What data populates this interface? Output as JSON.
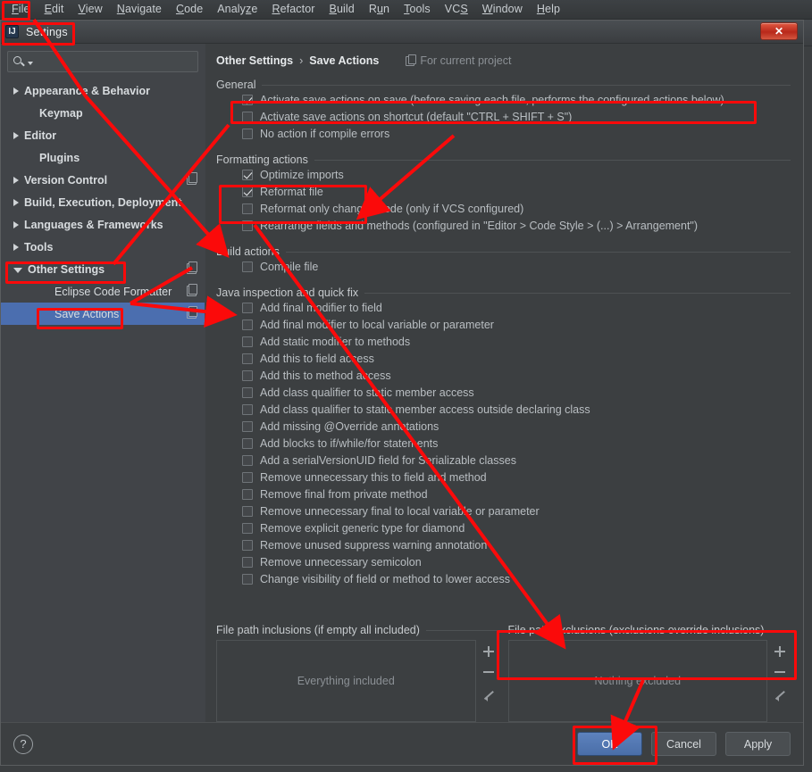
{
  "ide": {
    "menu": [
      {
        "label": "File",
        "mnemonic": "F"
      },
      {
        "label": "Edit",
        "mnemonic": "E"
      },
      {
        "label": "View",
        "mnemonic": "V"
      },
      {
        "label": "Navigate",
        "mnemonic": "N"
      },
      {
        "label": "Code",
        "mnemonic": "C"
      },
      {
        "label": "Analyze",
        "mnemonic": "z"
      },
      {
        "label": "Refactor",
        "mnemonic": "R"
      },
      {
        "label": "Build",
        "mnemonic": "B"
      },
      {
        "label": "Run",
        "mnemonic": "u"
      },
      {
        "label": "Tools",
        "mnemonic": "T"
      },
      {
        "label": "VCS",
        "mnemonic": "S"
      },
      {
        "label": "Window",
        "mnemonic": "W"
      },
      {
        "label": "Help",
        "mnemonic": "H"
      }
    ]
  },
  "dialog": {
    "title": "Settings",
    "title_icon": "settings-window-icon",
    "close_label": "✕"
  },
  "search": {
    "value": "",
    "placeholder": "",
    "icon": "search-icon",
    "caret_icon": "chevron-down-icon"
  },
  "sidebar": {
    "items": [
      {
        "label": "Appearance & Behavior",
        "arrow": "right",
        "bold": true,
        "indent": 0,
        "selected": false,
        "project_icon": false
      },
      {
        "label": "Keymap",
        "arrow": "none",
        "bold": true,
        "indent": 1,
        "selected": false,
        "project_icon": false
      },
      {
        "label": "Editor",
        "arrow": "right",
        "bold": true,
        "indent": 0,
        "selected": false,
        "project_icon": false
      },
      {
        "label": "Plugins",
        "arrow": "none",
        "bold": true,
        "indent": 1,
        "selected": false,
        "project_icon": false
      },
      {
        "label": "Version Control",
        "arrow": "right",
        "bold": true,
        "indent": 0,
        "selected": false,
        "project_icon": true
      },
      {
        "label": "Build, Execution, Deployment",
        "arrow": "right",
        "bold": true,
        "indent": 0,
        "selected": false,
        "project_icon": false
      },
      {
        "label": "Languages & Frameworks",
        "arrow": "right",
        "bold": true,
        "indent": 0,
        "selected": false,
        "project_icon": false
      },
      {
        "label": "Tools",
        "arrow": "right",
        "bold": true,
        "indent": 0,
        "selected": false,
        "project_icon": false
      },
      {
        "label": "Other Settings",
        "arrow": "down",
        "bold": true,
        "indent": 0,
        "selected": false,
        "project_icon": true
      },
      {
        "label": "Eclipse Code Formatter",
        "arrow": "none",
        "bold": false,
        "indent": 2,
        "selected": false,
        "project_icon": true
      },
      {
        "label": "Save Actions",
        "arrow": "none",
        "bold": false,
        "indent": 2,
        "selected": true,
        "project_icon": true
      }
    ]
  },
  "main": {
    "breadcrumb": {
      "parent": "Other Settings",
      "separator": "›",
      "current": "Save Actions",
      "scope_label": "For current project",
      "scope_icon": "project-scope-icon"
    },
    "sections": [
      {
        "title": "General",
        "items": [
          {
            "label": "Activate save actions on save (before saving each file, performs the configured actions below)",
            "checked": true
          },
          {
            "label": "Activate save actions on shortcut (default \"CTRL + SHIFT + S\")",
            "checked": false
          },
          {
            "label": "No action if compile errors",
            "checked": false
          }
        ]
      },
      {
        "title": "Formatting actions",
        "items": [
          {
            "label": "Optimize imports",
            "checked": true
          },
          {
            "label": "Reformat file",
            "checked": true
          },
          {
            "label": "Reformat only changed code (only if VCS configured)",
            "checked": false
          },
          {
            "label": "Rearrange fields and methods (configured in \"Editor > Code Style > (...) > Arrangement\")",
            "checked": false
          }
        ]
      },
      {
        "title": "Build actions",
        "items": [
          {
            "label": "Compile file",
            "checked": false
          }
        ]
      },
      {
        "title": "Java inspection and quick fix",
        "items": [
          {
            "label": "Add final modifier to field",
            "checked": false
          },
          {
            "label": "Add final modifier to local variable or parameter",
            "checked": false
          },
          {
            "label": "Add static modifier to methods",
            "checked": false
          },
          {
            "label": "Add this to field access",
            "checked": false
          },
          {
            "label": "Add this to method access",
            "checked": false
          },
          {
            "label": "Add class qualifier to static member access",
            "checked": false
          },
          {
            "label": "Add class qualifier to static member access outside declaring class",
            "checked": false
          },
          {
            "label": "Add missing @Override annotations",
            "checked": false
          },
          {
            "label": "Add blocks to if/while/for statements",
            "checked": false
          },
          {
            "label": "Add a serialVersionUID field for Serializable classes",
            "checked": false
          },
          {
            "label": "Remove unnecessary this to field and method",
            "checked": false
          },
          {
            "label": "Remove final from private method",
            "checked": false
          },
          {
            "label": "Remove unnecessary final to local variable or parameter",
            "checked": false
          },
          {
            "label": "Remove explicit generic type for diamond",
            "checked": false
          },
          {
            "label": "Remove unused suppress warning annotation",
            "checked": false
          },
          {
            "label": "Remove unnecessary semicolon",
            "checked": false
          },
          {
            "label": "Change visibility of field or method to lower access",
            "checked": false
          }
        ]
      }
    ],
    "paths": {
      "inclusions": {
        "title": "File path inclusions (if empty all included)",
        "empty_text": "Everything included",
        "add_icon": "plus-icon",
        "remove_icon": "minus-icon",
        "edit_icon": "pencil-icon"
      },
      "exclusions": {
        "title": "File path exclusions (exclusions override inclusions)",
        "empty_text": "Nothing excluded",
        "add_icon": "plus-icon",
        "remove_icon": "minus-icon",
        "edit_icon": "pencil-icon"
      }
    }
  },
  "footer": {
    "help_label": "?",
    "ok_label": "OK",
    "cancel_label": "Cancel",
    "apply_label": "Apply"
  },
  "annotation": {
    "color": "#fb0a0a"
  }
}
